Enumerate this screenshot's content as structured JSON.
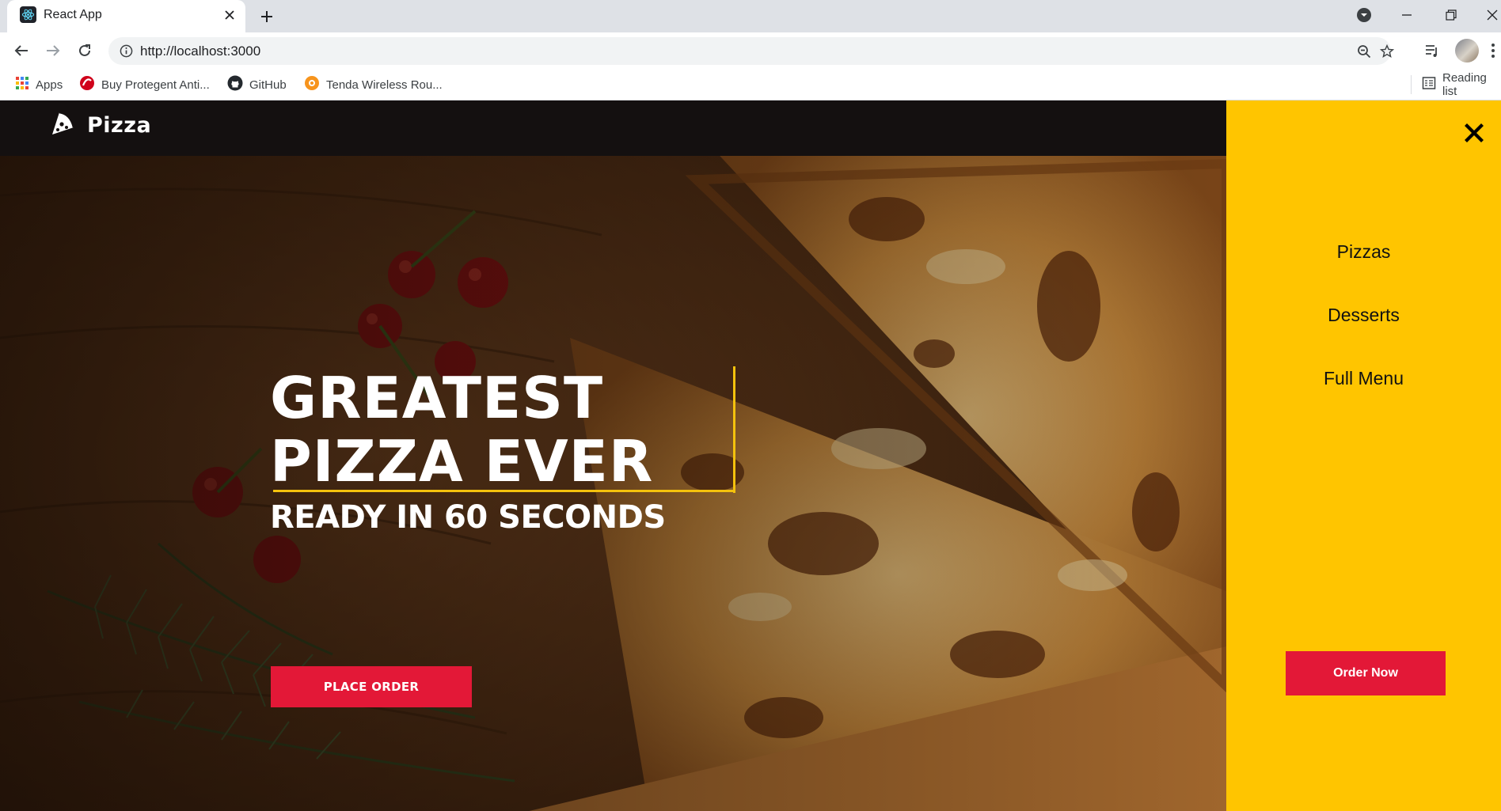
{
  "browser": {
    "tab_title": "React App",
    "url": "http://localhost:3000",
    "bookmarks": [
      {
        "label": "Apps",
        "icon": "apps-grid-icon"
      },
      {
        "label": "Buy Protegent Anti...",
        "icon": "protegent-icon"
      },
      {
        "label": "GitHub",
        "icon": "github-icon"
      },
      {
        "label": "Tenda Wireless Rou...",
        "icon": "tenda-icon"
      }
    ],
    "reading_list": "Reading list"
  },
  "site": {
    "logo_text": "Pizza",
    "headline_line1": "GREATEST",
    "headline_line2": "PIZZA EVER",
    "subhead": "READY IN 60 SECONDS",
    "cta": "PLACE ORDER"
  },
  "drawer": {
    "links": [
      "Pizzas",
      "Desserts",
      "Full Menu"
    ],
    "order_button": "Order Now"
  },
  "colors": {
    "accent_yellow": "#ffc500",
    "brand_red": "#e31837",
    "header_dark": "#141010"
  }
}
